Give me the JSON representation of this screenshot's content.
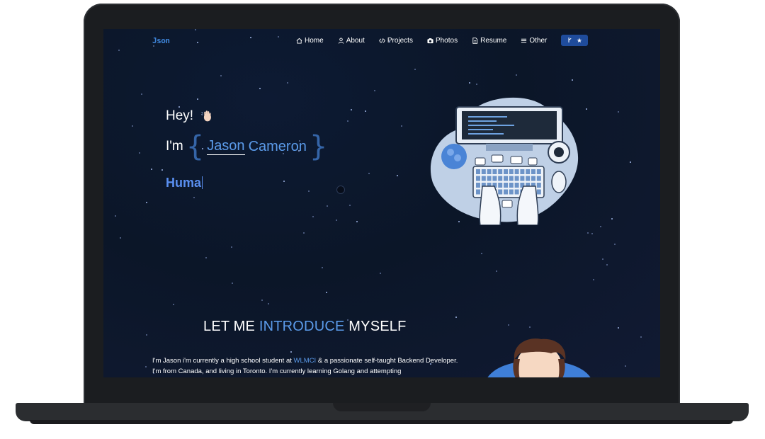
{
  "site": {
    "logo": "Json"
  },
  "nav": {
    "items": [
      {
        "label": "Home",
        "icon": "home-icon"
      },
      {
        "label": "About",
        "icon": "user-icon"
      },
      {
        "label": "Projects",
        "icon": "code-icon"
      },
      {
        "label": "Photos",
        "icon": "camera-icon"
      },
      {
        "label": "Resume",
        "icon": "document-icon"
      },
      {
        "label": "Other",
        "icon": "menu-icon"
      }
    ],
    "github_icon": "fork-icon",
    "star_icon": "star-icon"
  },
  "hero": {
    "greeting": "Hey!",
    "intro_prefix": "I'm",
    "first_name": "Jason",
    "last_name": "Cameron",
    "typed_text": "Huma"
  },
  "intro": {
    "heading_1": "LET ME",
    "heading_highlight": "INTRODUCE",
    "heading_2": "MYSELF",
    "text_1": "I'm Jason i'm currently a high school student at ",
    "school": "WLMCI",
    "text_2": " & a passionate self-taught Backend Developer. I'm from Canada, and living in Toronto. I'm currently learning Golang and attempting"
  },
  "colors": {
    "accent": "#5b9bea",
    "button": "#1f4c9c",
    "background": "#0b1628"
  }
}
